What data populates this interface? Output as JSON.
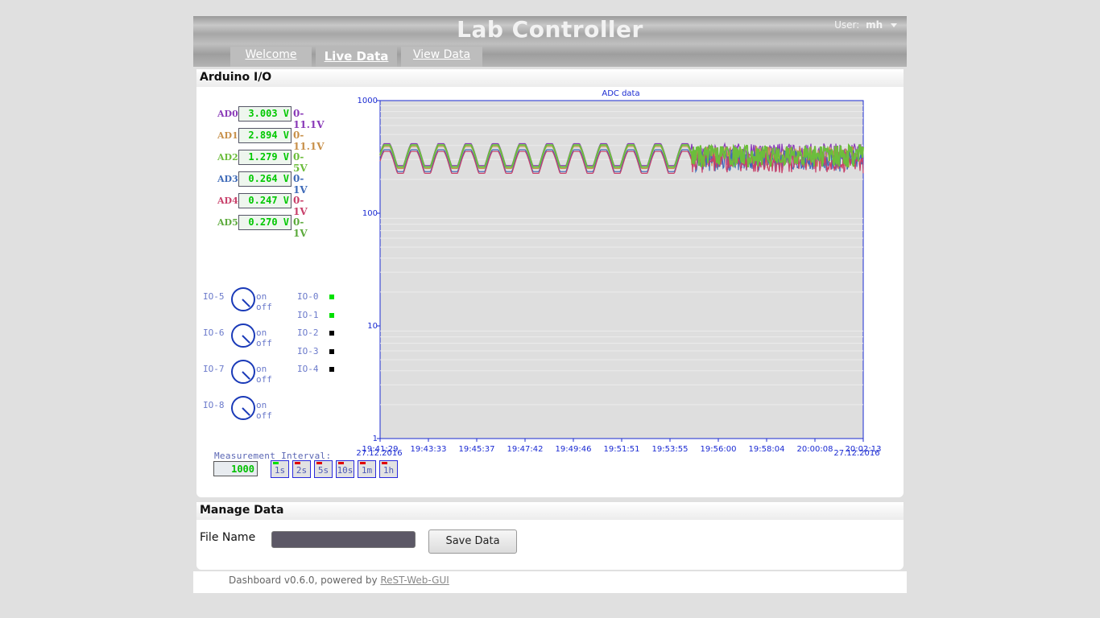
{
  "header": {
    "title": "Lab Controller",
    "user_label": "User:",
    "user_name": "mh"
  },
  "tabs": [
    {
      "label": "Welcome",
      "active": false
    },
    {
      "label": "Live Data",
      "active": true
    },
    {
      "label": "View Data",
      "active": false
    }
  ],
  "arduino_panel": {
    "title": "Arduino I/O",
    "adc": [
      {
        "name": "AD0",
        "value": "3.003 V",
        "range": "0-11.1V",
        "color": "#8a3ab8"
      },
      {
        "name": "AD1",
        "value": "2.894 V",
        "range": "0-11.1V",
        "color": "#c8904a"
      },
      {
        "name": "AD2",
        "value": "1.279 V",
        "range": "0-5V",
        "color": "#6cbd3c"
      },
      {
        "name": "AD3",
        "value": "0.264 V",
        "range": "0-1V",
        "color": "#3e6ab8"
      },
      {
        "name": "AD4",
        "value": "0.247 V",
        "range": "0-1V",
        "color": "#c8406a"
      },
      {
        "name": "AD5",
        "value": "0.270 V",
        "range": "0-1V",
        "color": "#5caa3c"
      }
    ],
    "knobs": [
      {
        "label": "IO-5",
        "on": "on",
        "off": "off"
      },
      {
        "label": "IO-6",
        "on": "on",
        "off": "off"
      },
      {
        "label": "IO-7",
        "on": "on",
        "off": "off"
      },
      {
        "label": "IO-8",
        "on": "on",
        "off": "off"
      }
    ],
    "digital": [
      {
        "label": "IO-0",
        "state": "on"
      },
      {
        "label": "IO-1",
        "state": "on"
      },
      {
        "label": "IO-2",
        "state": "off"
      },
      {
        "label": "IO-3",
        "state": "off"
      },
      {
        "label": "IO-4",
        "state": "off"
      }
    ],
    "measurement_label": "Measurement Interval:",
    "measurement_value": "1000",
    "interval_buttons": [
      "1s",
      "2s",
      "5s",
      "10s",
      "1m",
      "1h"
    ],
    "interval_active": "1s",
    "led_on_color": "#00e000",
    "led_off_color": "#000000"
  },
  "chart_data": {
    "type": "line",
    "title": "ADC data",
    "yscale": "log",
    "ylim": [
      1,
      1000
    ],
    "y_ticks": [
      "1000",
      "100",
      "10",
      "1"
    ],
    "x_ticks": [
      "19:41:29",
      "19:43:33",
      "19:45:37",
      "19:47:42",
      "19:49:46",
      "19:51:51",
      "19:53:55",
      "19:56:00",
      "19:58:04",
      "20:00:08",
      "20:02:13"
    ],
    "x_start_date": "27.12.2016",
    "x_end_date": "27.12.2016",
    "series": [
      {
        "color": "#8a3ab8",
        "level": 340
      },
      {
        "color": "#c8904a",
        "level": 320
      },
      {
        "color": "#3e6ab8",
        "level": 300
      },
      {
        "color": "#c8406a",
        "level": 290
      },
      {
        "color": "#6cbd3c",
        "level": 330
      }
    ]
  },
  "manage_panel": {
    "title": "Manage Data",
    "file_label": "File Name",
    "file_value": "",
    "save_label": "Save Data"
  },
  "footer": {
    "text": "Dashboard v0.6.0, powered by ",
    "link": "ReST-Web-GUI"
  }
}
